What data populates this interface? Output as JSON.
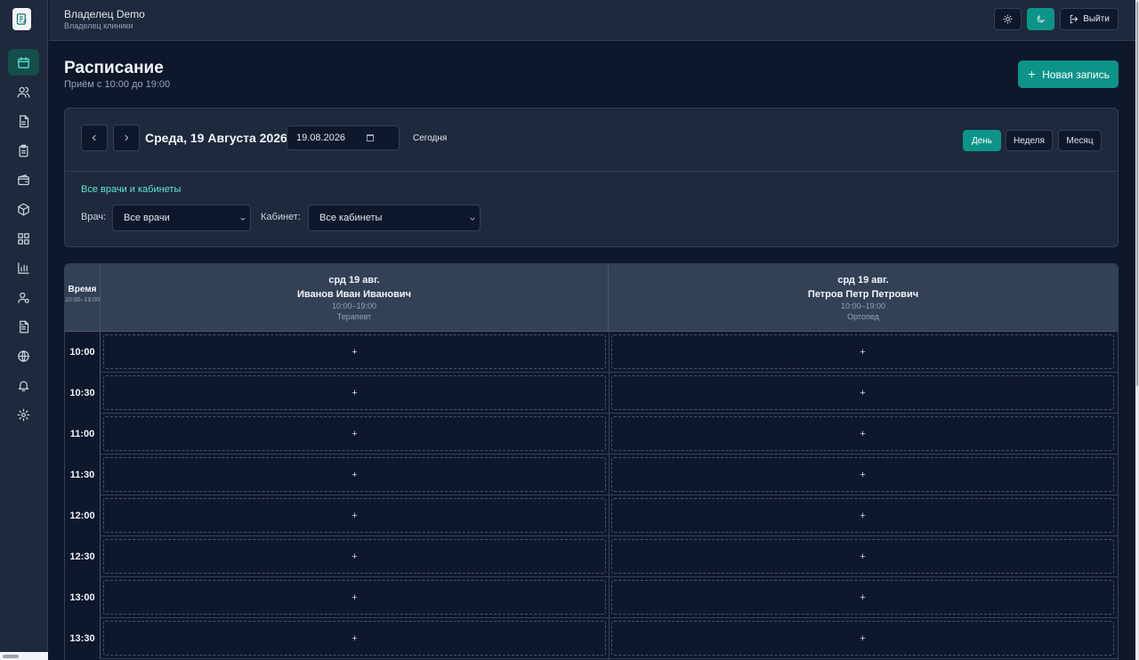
{
  "topbar": {
    "user_name": "Владелец Demo",
    "user_role": "Владелец клиники",
    "logout_label": "Выйти"
  },
  "sidebar": {
    "items": [
      {
        "icon": "calendar-icon",
        "active": true
      },
      {
        "icon": "users-icon",
        "active": false
      },
      {
        "icon": "document-icon",
        "active": false
      },
      {
        "icon": "clipboard-icon",
        "active": false
      },
      {
        "icon": "wallet-icon",
        "active": false
      },
      {
        "icon": "box-icon",
        "active": false
      },
      {
        "icon": "grid-icon",
        "active": false
      },
      {
        "icon": "bar-chart-icon",
        "active": false
      },
      {
        "icon": "user-settings-icon",
        "active": false
      },
      {
        "icon": "file-text-icon",
        "active": false
      },
      {
        "icon": "globe-icon",
        "active": false
      },
      {
        "icon": "bell-icon",
        "active": false
      },
      {
        "icon": "gear-icon",
        "active": false
      }
    ]
  },
  "page": {
    "title": "Расписание",
    "subtitle": "Приём с 10:00 до 19:00",
    "new_button": "Новая запись"
  },
  "toolbar": {
    "date_title": "Среда, 19 Августа 2026",
    "date_value": "19.08.2026",
    "today_label": "Сегодня",
    "views": [
      "День",
      "Неделя",
      "Месяц"
    ],
    "active_view": "День"
  },
  "filters": {
    "all_link": "Все врачи и кабинеты",
    "doctor_label": "Врач:",
    "doctor_value": "Все врачи",
    "room_label": "Кабинет:",
    "room_value": "Все кабинеты"
  },
  "grid": {
    "time_header": "Время",
    "time_range": "10:00–19:00",
    "doctors": [
      {
        "date": "срд 19 авг.",
        "name": "Иванов Иван Иванович",
        "hours": "10:00–19:00",
        "specialty": "Терапевт"
      },
      {
        "date": "срд 19 авг.",
        "name": "Петров Петр Петрович",
        "hours": "10:00–19:00",
        "specialty": "Ортопед"
      }
    ],
    "times": [
      "10:00",
      "10:30",
      "11:00",
      "11:30",
      "12:00",
      "12:30",
      "13:00",
      "13:30"
    ],
    "slot_label": "+"
  },
  "colors": {
    "accent": "#0d9488",
    "background": "#0f172a",
    "panel": "#1e293b"
  }
}
